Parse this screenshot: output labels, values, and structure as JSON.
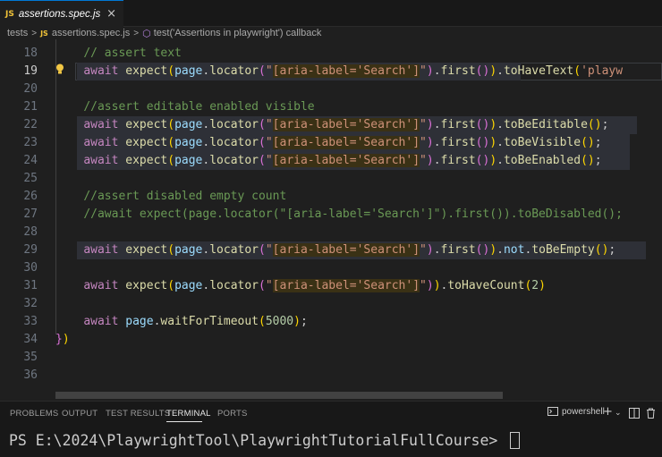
{
  "tab": {
    "lang_badge": "JS",
    "filename": "assertions.spec.js",
    "close": "×"
  },
  "breadcrumb": {
    "folder": "tests",
    "sep": ">",
    "lang_badge": "JS",
    "file": "assertions.spec.js",
    "symbol": "test('Assertions in playwright') callback"
  },
  "editor": {
    "lines": [
      {
        "n": "18",
        "text": "// assert text"
      },
      {
        "n": "19",
        "text": "await expect(page.locator(\"[aria-label='Search']\").first()).toHaveText('playw"
      },
      {
        "n": "20",
        "text": ""
      },
      {
        "n": "21",
        "text": "//assert editable enabled visible"
      },
      {
        "n": "22",
        "text": "await expect(page.locator(\"[aria-label='Search']\").first()).toBeEditable();"
      },
      {
        "n": "23",
        "text": "await expect(page.locator(\"[aria-label='Search']\").first()).toBeVisible();"
      },
      {
        "n": "24",
        "text": "await expect(page.locator(\"[aria-label='Search']\").first()).toBeEnabled();"
      },
      {
        "n": "25",
        "text": ""
      },
      {
        "n": "26",
        "text": "//assert disabled empty count"
      },
      {
        "n": "27",
        "text": "//await expect(page.locator(\"[aria-label='Search']\").first()).toBeDisabled();"
      },
      {
        "n": "28",
        "text": ""
      },
      {
        "n": "29",
        "text": "await expect(page.locator(\"[aria-label='Search']\").first()).not.toBeEmpty();"
      },
      {
        "n": "30",
        "text": ""
      },
      {
        "n": "31",
        "text": "await expect(page.locator(\"[aria-label='Search']\")).toHaveCount(2)"
      },
      {
        "n": "32",
        "text": ""
      },
      {
        "n": "33",
        "text": "await page.waitForTimeout(5000);"
      },
      {
        "n": "34",
        "text": "})"
      },
      {
        "n": "35",
        "text": ""
      },
      {
        "n": "36",
        "text": ""
      }
    ]
  },
  "panel": {
    "tabs": [
      "PROBLEMS",
      "OUTPUT",
      "TEST RESULTS",
      "TERMINAL",
      "PORTS"
    ],
    "active_tab": "TERMINAL",
    "shell": "powershell",
    "prompt": "PS E:\\2024\\PlaywrightTool\\PlaywrightTutorialFullCourse> "
  },
  "colors": {
    "keyword": "#c586c0",
    "function": "#dcdcaa",
    "variable": "#9cdcfe",
    "string": "#ce9178",
    "comment": "#6a9955",
    "number": "#b5cea8",
    "accent": "#0078d4"
  },
  "icons": {
    "tab_close": "close-icon",
    "breadcrumb_symbol": "cube-icon",
    "lightbulb": "lightbulb-icon",
    "terminal_new": "plus-icon",
    "terminal_split": "split-icon",
    "terminal_trash": "trash-icon"
  }
}
